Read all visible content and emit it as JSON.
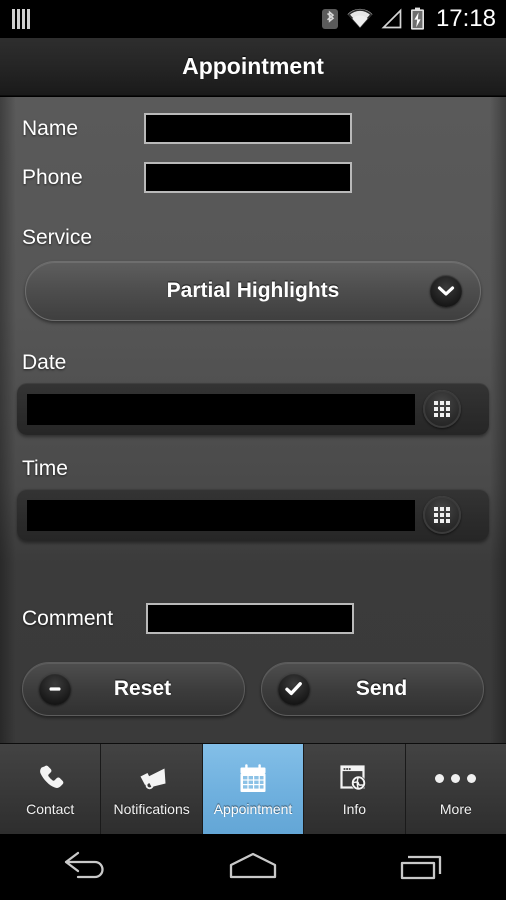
{
  "status_bar": {
    "sim_icon": "sim-bars-icon",
    "bluetooth_icon": "bluetooth-icon",
    "wifi_icon": "wifi-icon",
    "signal_icon": "cellular-signal-icon",
    "battery_icon": "battery-charging-icon",
    "clock": "17:18"
  },
  "title_bar": {
    "title": "Appointment"
  },
  "form": {
    "name": {
      "label": "Name",
      "value": "",
      "placeholder": ""
    },
    "phone": {
      "label": "Phone",
      "value": "",
      "placeholder": ""
    },
    "service": {
      "label": "Service",
      "selected": "Partial Highlights",
      "dropdown_icon": "chevron-down-icon"
    },
    "date": {
      "label": "Date",
      "value": "",
      "placeholder": "",
      "picker_icon": "grid-picker-icon"
    },
    "time": {
      "label": "Time",
      "value": "",
      "placeholder": "",
      "picker_icon": "grid-picker-icon"
    },
    "comment": {
      "label": "Comment",
      "value": "",
      "placeholder": ""
    }
  },
  "actions": {
    "reset": {
      "label": "Reset",
      "icon": "minus-circle-icon"
    },
    "send": {
      "label": "Send",
      "icon": "check-circle-icon"
    }
  },
  "tab_bar": {
    "active_index": 2,
    "active_color": "#6fb0de",
    "tabs": [
      {
        "label": "Contact",
        "icon": "phone-icon"
      },
      {
        "label": "Notifications",
        "icon": "megaphone-icon"
      },
      {
        "label": "Appointment",
        "icon": "calendar-icon"
      },
      {
        "label": "Info",
        "icon": "browser-globe-icon"
      },
      {
        "label": "More",
        "icon": "ellipsis-icon"
      }
    ]
  },
  "nav_bar": {
    "back": "back-icon",
    "home": "home-icon",
    "recents": "recent-apps-icon"
  }
}
